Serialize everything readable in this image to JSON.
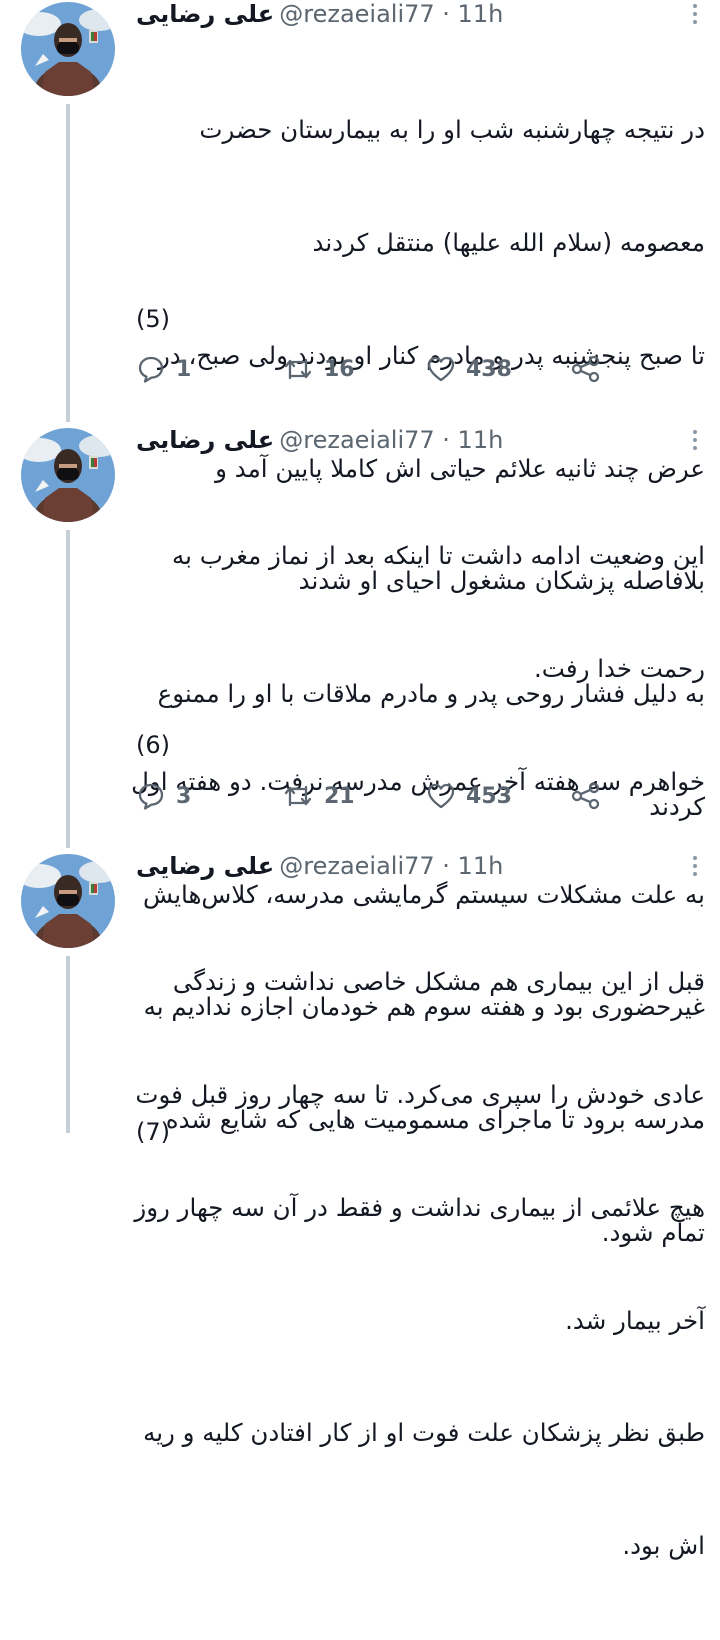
{
  "tweets": [
    {
      "name": "علی رضایی",
      "handle": "@rezaeiali77 · 11h",
      "lines": [
        "در نتیجه چهارشنبه شب او را به بیمارستان حضرت",
        "معصومه (سلام الله علیها) منتقل کردند",
        "تا صبح پنجشنبه پدر و مادرم کنار او بودند ولی صبح، در",
        "عرض چند ثانیه علائم حیاتی اش کاملا پایین آمد و",
        "بلافاصله پزشکان مشغول احیای او شدند",
        "به دلیل فشار روحی پدر و مادرم ملاقات با او را ممنوع",
        "کردند"
      ],
      "counter": "(5)",
      "replies": "1",
      "retweets": "16",
      "likes": "438"
    },
    {
      "name": "علی رضایی",
      "handle": "@rezaeiali77 · 11h",
      "lines": [
        "این وضعیت ادامه داشت تا اینکه بعد از نماز مغرب به",
        "رحمت خدا رفت.",
        "خواهرم سه هفته آخر عمرش مدرسه نرفت. دو هفته اول",
        "به علت مشکلات سیستم گرمایشی مدرسه، کلاس‌هایش",
        "غیرحضوری بود و هفته سوم هم خودمان اجازه ندادیم به",
        "مدرسه برود تا ماجرای مسمومیت هایی که شایع شده",
        "تمام شود."
      ],
      "counter": "(6)",
      "replies": "3",
      "retweets": "21",
      "likes": "453"
    },
    {
      "name": "علی رضایی",
      "handle": "@rezaeiali77 · 11h",
      "lines": [
        "قبل از این بیماری هم مشکل خاصی نداشت و زندگی",
        "عادی خودش را سپری می‌کرد. تا سه چهار روز قبل فوت",
        "هیچ علائمی از بیماری نداشت و فقط در آن سه چهار روز",
        "آخر بیمار شد.",
        "طبق نظر پزشکان علت فوت او از کار افتادن کلیه و ریه",
        "اش بود."
      ],
      "counter": "(7)"
    }
  ],
  "icons": {
    "reply": "reply-icon",
    "retweet": "retweet-icon",
    "like": "heart-icon",
    "share": "share-icon",
    "more": "more-dots-icon"
  },
  "colors": {
    "text": "#141823",
    "muted": "#5b6670",
    "thread_line": "#c4cfd6"
  }
}
